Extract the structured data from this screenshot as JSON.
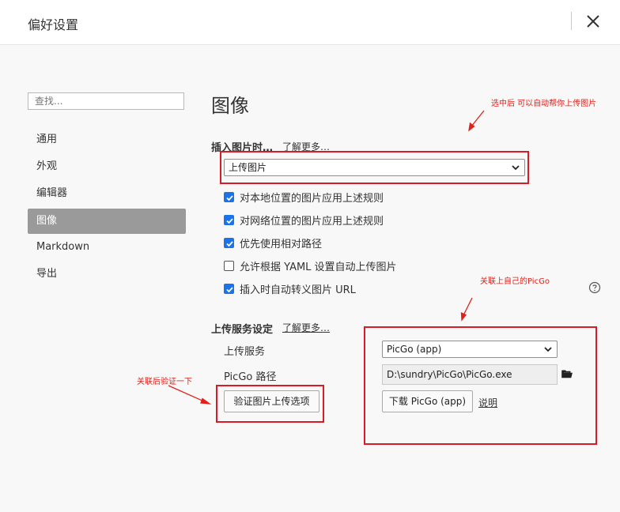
{
  "window": {
    "title": "偏好设置"
  },
  "sidebar": {
    "search_placeholder": "查找...",
    "items": [
      {
        "label": "通用"
      },
      {
        "label": "外观"
      },
      {
        "label": "编辑器"
      },
      {
        "label": "图像",
        "active": true
      },
      {
        "label": "Markdown"
      },
      {
        "label": "导出"
      }
    ]
  },
  "main": {
    "heading": "图像",
    "insert": {
      "label": "插入图片时…",
      "learn_more": "了解更多…",
      "selected": "上传图片"
    },
    "checkboxes": [
      {
        "label": "对本地位置的图片应用上述规则",
        "checked": true
      },
      {
        "label": "对网络位置的图片应用上述规则",
        "checked": true
      },
      {
        "label": "优先使用相对路径",
        "checked": true
      },
      {
        "label": "允许根据 YAML 设置自动上传图片",
        "checked": false
      },
      {
        "label": "插入时自动转义图片 URL",
        "checked": true
      }
    ],
    "upload": {
      "label": "上传服务设定",
      "learn_more": "了解更多…",
      "service_label": "上传服务",
      "service_selected": "PicGo (app)",
      "path_label": "PicGo 路径",
      "path_value": "D:\\sundry\\PicGo\\PicGo.exe",
      "verify_button": "验证图片上传选项",
      "download_button": "下载 PicGo (app)",
      "docs_link": "说明"
    }
  },
  "annotations": {
    "note1": "选中后 可以自动帮你上传图片",
    "note2": "关联上自己的PicGo",
    "note3": "关联后验证一下",
    "color": "#e0221c"
  },
  "colors": {
    "accent": "#1a73e8",
    "active_nav": "#9a9a9a",
    "annotation_box": "#d91b25"
  }
}
